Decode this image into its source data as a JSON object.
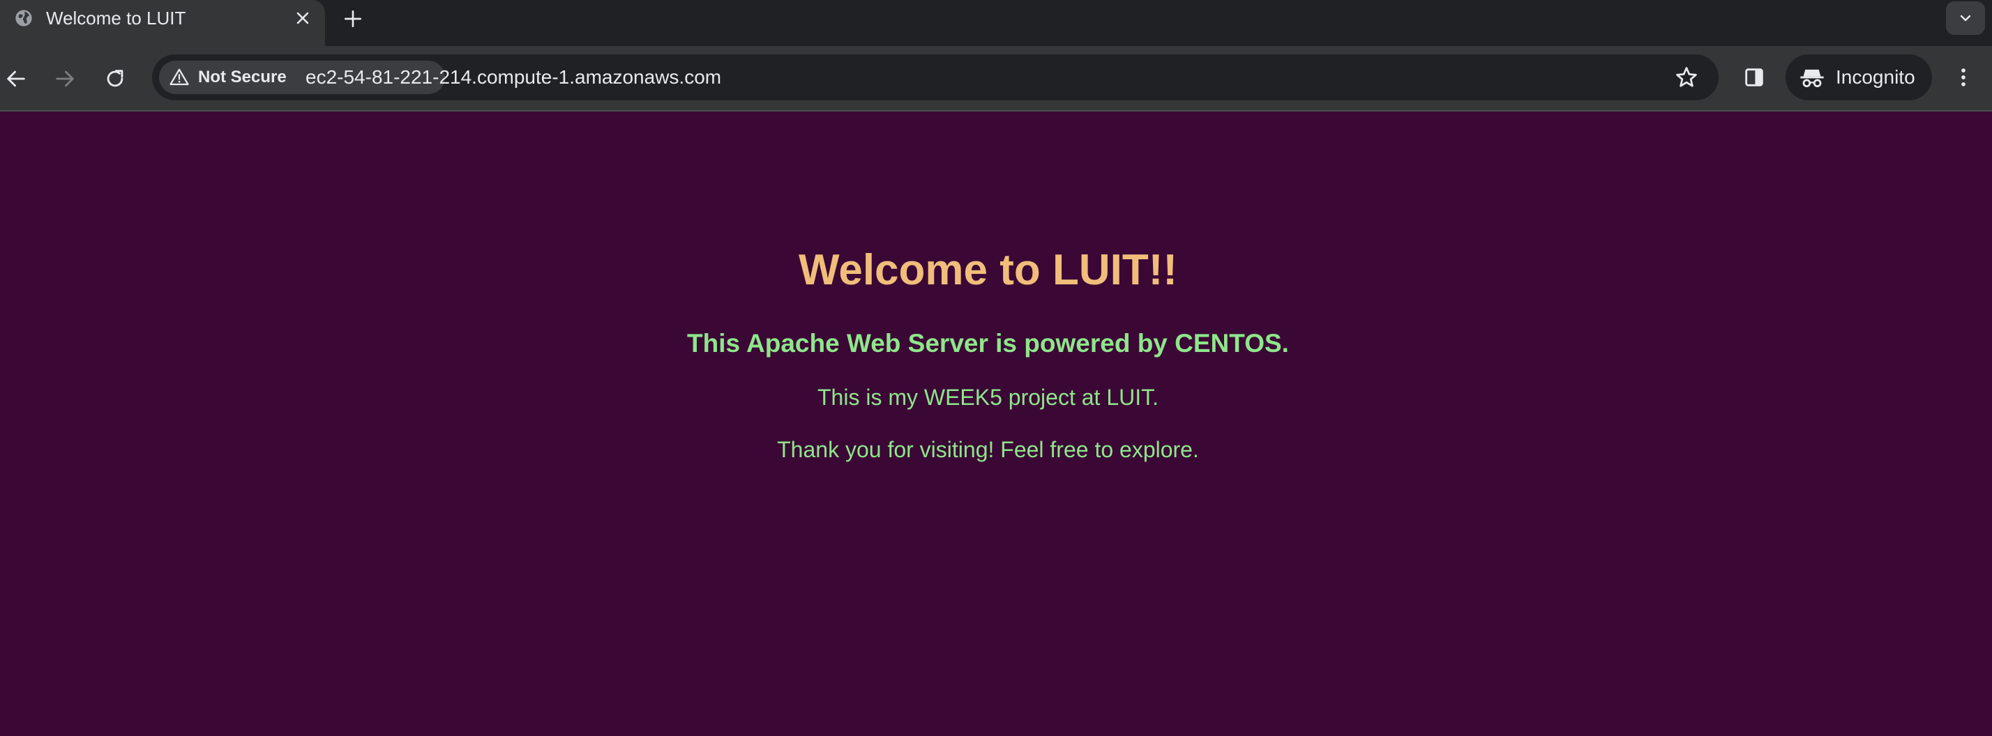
{
  "browser": {
    "tab": {
      "title": "Welcome to LUIT"
    },
    "address_bar": {
      "security_label": "Not Secure",
      "url": "ec2-54-81-221-214.compute-1.amazonaws.com"
    },
    "profile": {
      "label": "Incognito"
    },
    "colors": {
      "tab_strip": "#202124",
      "toolbar": "#353638",
      "icon": "#e8eaed"
    },
    "icons": [
      "globe-icon",
      "close-icon",
      "plus-icon",
      "chevron-down-icon",
      "back-arrow-icon",
      "forward-arrow-icon",
      "reload-icon",
      "warning-icon",
      "star-icon",
      "side-panel-icon",
      "incognito-icon",
      "more-vert-icon"
    ]
  },
  "page": {
    "heading": "Welcome to LUIT!!",
    "subheading": "This Apache Web Server is powered by CENTOS.",
    "paragraphs": [
      "This is my WEEK5 project at LUIT.",
      "Thank you for visiting! Feel free to explore."
    ],
    "colors": {
      "background": "#3b0835",
      "heading": "#f0be7a",
      "text": "#8ee68a"
    }
  }
}
